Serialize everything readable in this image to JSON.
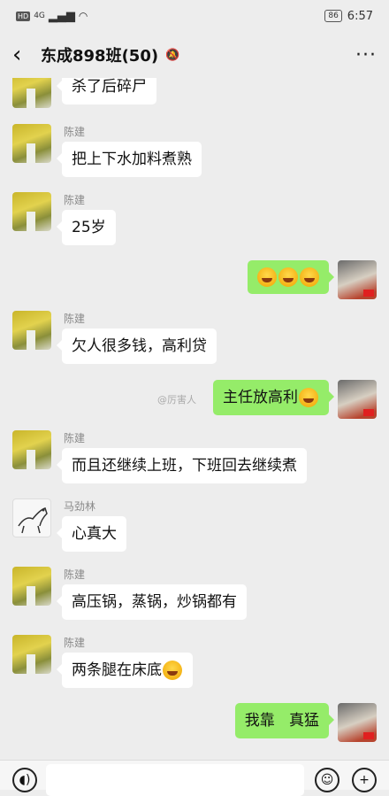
{
  "status": {
    "network": "4G",
    "hd": "HD",
    "battery": "86",
    "time": "6:57"
  },
  "header": {
    "title": "东成898班(50)",
    "back_glyph": "‹",
    "more_glyph": "···"
  },
  "messages": [
    {
      "sender": "",
      "text": "杀了后碎尸"
    },
    {
      "sender": "陈建",
      "text": "把上下水加料煮熟"
    },
    {
      "sender": "陈建",
      "text": "25岁"
    },
    {
      "sender": "me",
      "text": ""
    },
    {
      "sender": "陈建",
      "text": "欠人很多钱，高利贷"
    },
    {
      "sender": "me",
      "text": "主任放高利"
    },
    {
      "sender": "陈建",
      "text": "而且还继续上班，下班回去继续煮"
    },
    {
      "sender": "马劲林",
      "text": "心真大"
    },
    {
      "sender": "陈建",
      "text": "高压锅，蒸锅，炒锅都有"
    },
    {
      "sender": "陈建",
      "text": "两条腿在床底"
    },
    {
      "sender": "me",
      "text": "我靠   真猛"
    }
  ],
  "watermark": "@厉害人",
  "icons": {
    "voice": "voice-icon",
    "emoji": "emoji-icon",
    "plus": "plus-icon"
  }
}
